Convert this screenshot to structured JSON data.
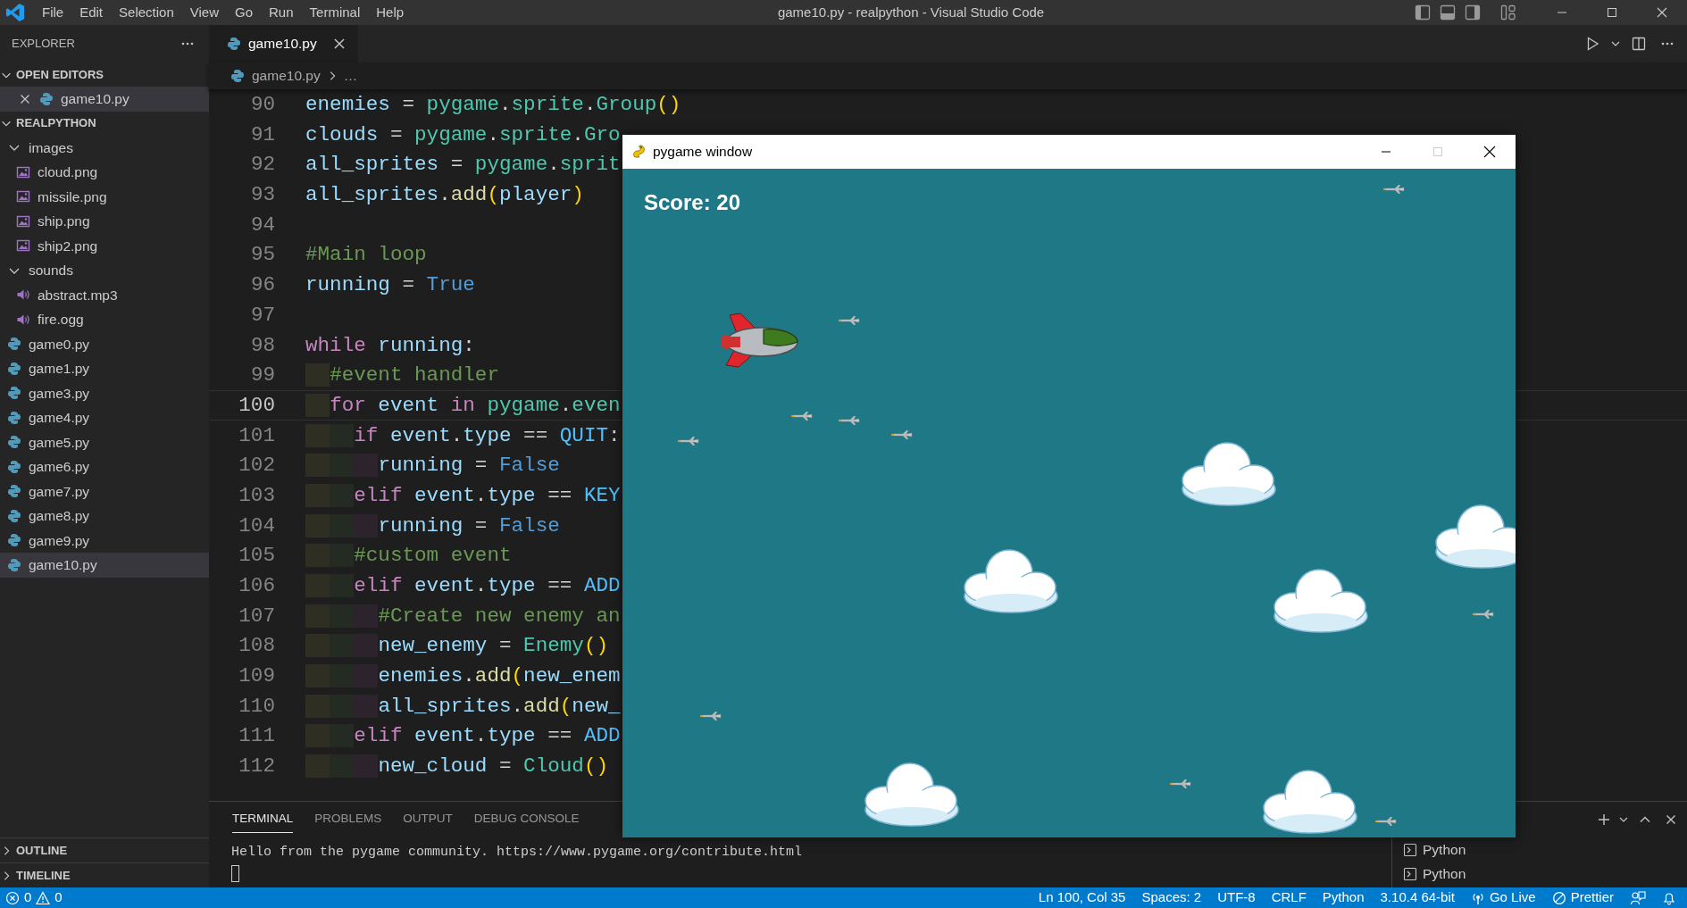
{
  "window": {
    "title": "game10.py - realpython - Visual Studio Code"
  },
  "menu": [
    "File",
    "Edit",
    "Selection",
    "View",
    "Go",
    "Run",
    "Terminal",
    "Help"
  ],
  "sidebar": {
    "title": "EXPLORER",
    "sections": [
      {
        "title": "OPEN EDITORS",
        "expanded": true,
        "items": [
          {
            "label": "game10.py",
            "kind": "python",
            "selected": true
          }
        ]
      },
      {
        "title": "REALPYTHON",
        "expanded": true,
        "items": [
          {
            "label": "images",
            "kind": "folder",
            "expanded": true,
            "selected": false,
            "children": [
              {
                "label": "cloud.png",
                "kind": "image",
                "selected": false
              },
              {
                "label": "missile.png",
                "kind": "image",
                "selected": false
              },
              {
                "label": "ship.png",
                "kind": "image",
                "selected": false
              },
              {
                "label": "ship2.png",
                "kind": "image",
                "selected": false
              }
            ]
          },
          {
            "label": "sounds",
            "kind": "folder",
            "expanded": true,
            "selected": false,
            "children": [
              {
                "label": "abstract.mp3",
                "kind": "audio",
                "selected": false
              },
              {
                "label": "fire.ogg",
                "kind": "audio",
                "selected": false
              }
            ]
          },
          {
            "label": "game0.py",
            "kind": "python",
            "selected": false
          },
          {
            "label": "game1.py",
            "kind": "python",
            "selected": false
          },
          {
            "label": "game3.py",
            "kind": "python",
            "selected": false
          },
          {
            "label": "game4.py",
            "kind": "python",
            "selected": false
          },
          {
            "label": "game5.py",
            "kind": "python",
            "selected": false
          },
          {
            "label": "game6.py",
            "kind": "python",
            "selected": false
          },
          {
            "label": "game7.py",
            "kind": "python",
            "selected": false
          },
          {
            "label": "game8.py",
            "kind": "python",
            "selected": false
          },
          {
            "label": "game9.py",
            "kind": "python",
            "selected": false
          },
          {
            "label": "game10.py",
            "kind": "python",
            "selected": true
          }
        ]
      }
    ],
    "footer_sections": [
      {
        "title": "OUTLINE",
        "expanded": false
      },
      {
        "title": "TIMELINE",
        "expanded": false
      }
    ]
  },
  "tabs": [
    {
      "label": "game10.py",
      "selected": true
    }
  ],
  "breadcrumb": [
    "game10.py",
    "…"
  ],
  "editor": {
    "lines": [
      {
        "number": "90",
        "current": false,
        "tokens": [
          {
            "text": "enemies",
            "kind": "variable"
          },
          {
            "text": " = ",
            "kind": "plain"
          },
          {
            "text": "pygame",
            "kind": "class"
          },
          {
            "text": ".",
            "kind": "plain"
          },
          {
            "text": "sprite",
            "kind": "class"
          },
          {
            "text": ".",
            "kind": "plain"
          },
          {
            "text": "Group",
            "kind": "class"
          },
          {
            "text": "()",
            "kind": "bracket"
          }
        ]
      },
      {
        "number": "91",
        "current": false,
        "tokens": [
          {
            "text": "clouds",
            "kind": "variable"
          },
          {
            "text": " = ",
            "kind": "plain"
          },
          {
            "text": "pygame",
            "kind": "class"
          },
          {
            "text": ".",
            "kind": "plain"
          },
          {
            "text": "sprite",
            "kind": "class"
          },
          {
            "text": ".",
            "kind": "plain"
          },
          {
            "text": "Gro",
            "kind": "class"
          }
        ]
      },
      {
        "number": "92",
        "current": false,
        "tokens": [
          {
            "text": "all_sprites",
            "kind": "variable"
          },
          {
            "text": " = ",
            "kind": "plain"
          },
          {
            "text": "pygame",
            "kind": "class"
          },
          {
            "text": ".",
            "kind": "plain"
          },
          {
            "text": "sprit",
            "kind": "class"
          }
        ]
      },
      {
        "number": "93",
        "current": false,
        "tokens": [
          {
            "text": "all_sprites",
            "kind": "variable"
          },
          {
            "text": ".",
            "kind": "plain"
          },
          {
            "text": "add",
            "kind": "function"
          },
          {
            "text": "(",
            "kind": "bracket"
          },
          {
            "text": "player",
            "kind": "variable"
          },
          {
            "text": ")",
            "kind": "bracket"
          }
        ]
      },
      {
        "number": "94",
        "current": false
      },
      {
        "number": "95",
        "current": false,
        "tokens": [
          {
            "text": "#Main loop",
            "kind": "comment"
          }
        ]
      },
      {
        "number": "96",
        "current": false,
        "tokens": [
          {
            "text": "running",
            "kind": "variable"
          },
          {
            "text": " = ",
            "kind": "plain"
          },
          {
            "text": "True",
            "kind": "constant"
          }
        ]
      },
      {
        "number": "97",
        "current": false
      },
      {
        "number": "98",
        "current": false,
        "tokens": [
          {
            "text": "while ",
            "kind": "keyword"
          },
          {
            "text": "running",
            "kind": "variable"
          },
          {
            "text": ":",
            "kind": "plain"
          }
        ],
        "children": [
          {
            "number": "99",
            "current": false,
            "tokens": [
              {
                "text": "#event handler",
                "kind": "comment"
              }
            ]
          },
          {
            "number": "100",
            "current": true,
            "tokens": [
              {
                "text": "for ",
                "kind": "keyword"
              },
              {
                "text": "event ",
                "kind": "variable"
              },
              {
                "text": "in ",
                "kind": "keyword"
              },
              {
                "text": "pygame",
                "kind": "class"
              },
              {
                "text": ".",
                "kind": "plain"
              },
              {
                "text": "even",
                "kind": "class"
              }
            ],
            "children": [
              {
                "number": "101",
                "current": false,
                "tokens": [
                  {
                    "text": "if ",
                    "kind": "keyword"
                  },
                  {
                    "text": "event",
                    "kind": "variable"
                  },
                  {
                    "text": ".",
                    "kind": "plain"
                  },
                  {
                    "text": "type",
                    "kind": "variable"
                  },
                  {
                    "text": " == ",
                    "kind": "plain"
                  },
                  {
                    "text": "QUIT",
                    "kind": "enum"
                  },
                  {
                    "text": ":",
                    "kind": "plain"
                  }
                ],
                "children": [
                  {
                    "number": "102",
                    "current": false,
                    "tokens": [
                      {
                        "text": "running",
                        "kind": "variable"
                      },
                      {
                        "text": " = ",
                        "kind": "plain"
                      },
                      {
                        "text": "False",
                        "kind": "constant"
                      }
                    ]
                  }
                ]
              },
              {
                "number": "103",
                "current": false,
                "tokens": [
                  {
                    "text": "elif ",
                    "kind": "keyword"
                  },
                  {
                    "text": "event",
                    "kind": "variable"
                  },
                  {
                    "text": ".",
                    "kind": "plain"
                  },
                  {
                    "text": "type",
                    "kind": "variable"
                  },
                  {
                    "text": " == ",
                    "kind": "plain"
                  },
                  {
                    "text": "KEY",
                    "kind": "enum"
                  }
                ],
                "children": [
                  {
                    "number": "104",
                    "current": false,
                    "tokens": [
                      {
                        "text": "running",
                        "kind": "variable"
                      },
                      {
                        "text": " = ",
                        "kind": "plain"
                      },
                      {
                        "text": "False",
                        "kind": "constant"
                      }
                    ]
                  }
                ]
              },
              {
                "number": "105",
                "current": false,
                "tokens": [
                  {
                    "text": "#custom event",
                    "kind": "comment"
                  }
                ]
              },
              {
                "number": "106",
                "current": false,
                "tokens": [
                  {
                    "text": "elif ",
                    "kind": "keyword"
                  },
                  {
                    "text": "event",
                    "kind": "variable"
                  },
                  {
                    "text": ".",
                    "kind": "plain"
                  },
                  {
                    "text": "type",
                    "kind": "variable"
                  },
                  {
                    "text": " == ",
                    "kind": "plain"
                  },
                  {
                    "text": "ADD",
                    "kind": "enum"
                  }
                ],
                "children": [
                  {
                    "number": "107",
                    "current": false,
                    "tokens": [
                      {
                        "text": "#Create new enemy an",
                        "kind": "comment"
                      }
                    ]
                  },
                  {
                    "number": "108",
                    "current": false,
                    "tokens": [
                      {
                        "text": "new_enemy",
                        "kind": "variable"
                      },
                      {
                        "text": " = ",
                        "kind": "plain"
                      },
                      {
                        "text": "Enemy",
                        "kind": "class"
                      },
                      {
                        "text": "()",
                        "kind": "bracket"
                      }
                    ]
                  },
                  {
                    "number": "109",
                    "current": false,
                    "tokens": [
                      {
                        "text": "enemies",
                        "kind": "variable"
                      },
                      {
                        "text": ".",
                        "kind": "plain"
                      },
                      {
                        "text": "add",
                        "kind": "function"
                      },
                      {
                        "text": "(",
                        "kind": "bracket"
                      },
                      {
                        "text": "new_enem",
                        "kind": "variable"
                      }
                    ]
                  },
                  {
                    "number": "110",
                    "current": false,
                    "tokens": [
                      {
                        "text": "all_sprites",
                        "kind": "variable"
                      },
                      {
                        "text": ".",
                        "kind": "plain"
                      },
                      {
                        "text": "add",
                        "kind": "function"
                      },
                      {
                        "text": "(",
                        "kind": "bracket"
                      },
                      {
                        "text": "new_",
                        "kind": "variable"
                      }
                    ]
                  }
                ]
              },
              {
                "number": "111",
                "current": false,
                "tokens": [
                  {
                    "text": "elif ",
                    "kind": "keyword"
                  },
                  {
                    "text": "event",
                    "kind": "variable"
                  },
                  {
                    "text": ".",
                    "kind": "plain"
                  },
                  {
                    "text": "type",
                    "kind": "variable"
                  },
                  {
                    "text": " == ",
                    "kind": "plain"
                  },
                  {
                    "text": "ADD",
                    "kind": "enum"
                  }
                ],
                "children": [
                  {
                    "number": "112",
                    "current": false,
                    "tokens": [
                      {
                        "text": "new_cloud",
                        "kind": "variable"
                      },
                      {
                        "text": " = ",
                        "kind": "plain"
                      },
                      {
                        "text": "Cloud",
                        "kind": "class"
                      },
                      {
                        "text": "()",
                        "kind": "bracket"
                      }
                    ]
                  }
                ]
              }
            ]
          }
        ]
      }
    ]
  },
  "panel": {
    "tabs": [
      {
        "label": "TERMINAL",
        "selected": true
      },
      {
        "label": "PROBLEMS",
        "selected": false
      },
      {
        "label": "OUTPUT",
        "selected": false
      },
      {
        "label": "DEBUG CONSOLE",
        "selected": false
      }
    ],
    "terminal_output": "Hello from the pygame community. https://www.pygame.org/contribute.html",
    "terminals": [
      {
        "label": "Python"
      },
      {
        "label": "Python"
      }
    ]
  },
  "status_bar": {
    "errors": "0",
    "warnings": "0",
    "items": [
      {
        "label": "Ln 100, Col 35",
        "kind": "text"
      },
      {
        "label": "Spaces: 2",
        "kind": "text"
      },
      {
        "label": "UTF-8",
        "kind": "text"
      },
      {
        "label": "CRLF",
        "kind": "text"
      },
      {
        "label": "Python",
        "kind": "text"
      },
      {
        "label": "3.10.4 64-bit",
        "kind": "text"
      },
      {
        "label": "Go Live",
        "kind": "live"
      },
      {
        "label": "Prettier",
        "kind": "prettier"
      }
    ]
  },
  "pygame_window": {
    "title": "pygame window",
    "score": "Score: 20"
  }
}
